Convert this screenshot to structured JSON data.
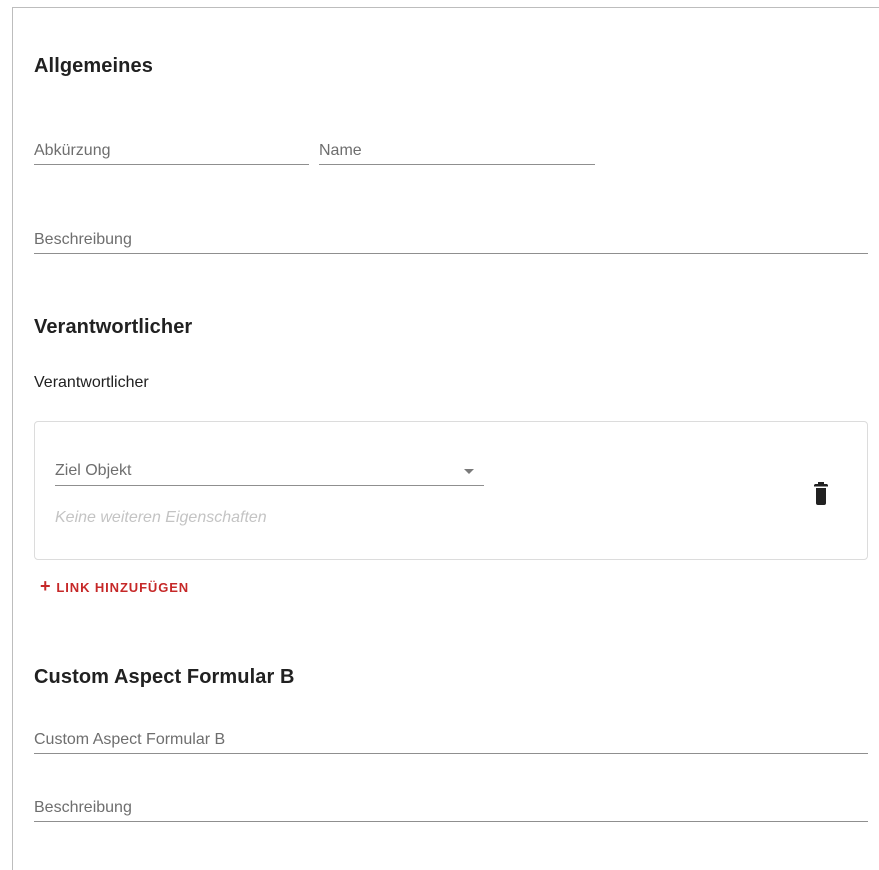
{
  "sections": {
    "general": {
      "title": "Allgemeines",
      "abbreviation_placeholder": "Abkürzung",
      "name_placeholder": "Name",
      "description_placeholder": "Beschreibung"
    },
    "responsible": {
      "title": "Verantwortlicher",
      "label": "Verantwortlicher",
      "card": {
        "select_label": "Ziel Objekt",
        "hint": "Keine weiteren Eigenschaften",
        "delete_icon": "trash-icon"
      },
      "add_link_icon": "plus-icon",
      "add_link_label": "LINK HINZUFÜGEN"
    },
    "custom_aspect": {
      "title": "Custom Aspect Formular B",
      "field_placeholder": "Custom Aspect Formular B",
      "description_placeholder": "Beschreibung"
    }
  },
  "colors": {
    "accent": "#c62828",
    "text": "#212121",
    "hint": "#c4c4c4"
  }
}
